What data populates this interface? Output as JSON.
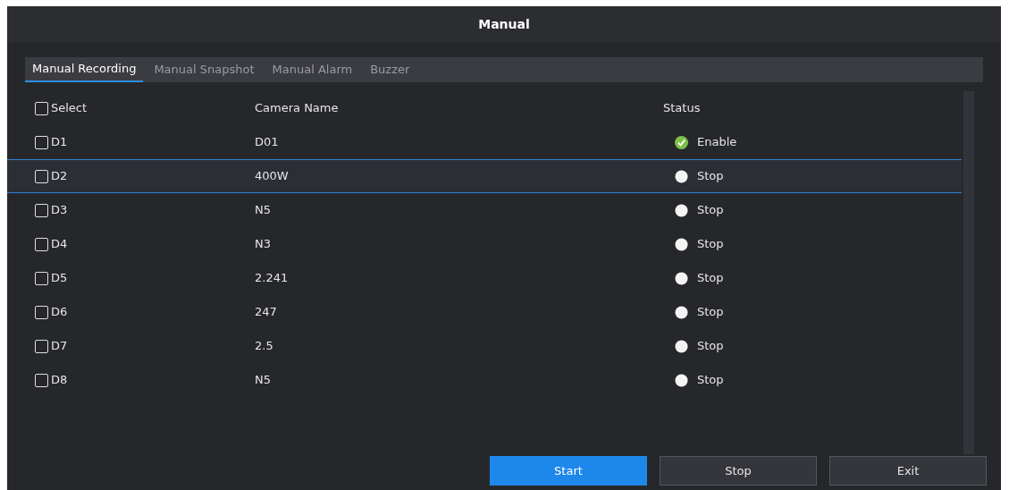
{
  "window": {
    "title": "Manual"
  },
  "tabs": [
    {
      "label": "Manual Recording",
      "selected": true
    },
    {
      "label": "Manual Snapshot",
      "selected": false
    },
    {
      "label": "Manual Alarm",
      "selected": false
    },
    {
      "label": "Buzzer",
      "selected": false
    }
  ],
  "table": {
    "select_all": {
      "label": "Select",
      "checked": false
    },
    "columns": [
      "Camera Name",
      "Status"
    ],
    "rows": [
      {
        "channel": "D1",
        "checked": false,
        "selected": false,
        "camera_name": "D01",
        "status": "Enable",
        "recording": true
      },
      {
        "channel": "D2",
        "checked": false,
        "selected": true,
        "camera_name": "400W",
        "status": "Stop",
        "recording": false
      },
      {
        "channel": "D3",
        "checked": false,
        "selected": false,
        "camera_name": "N5",
        "status": "Stop",
        "recording": false
      },
      {
        "channel": "D4",
        "checked": false,
        "selected": false,
        "camera_name": "N3",
        "status": "Stop",
        "recording": false
      },
      {
        "channel": "D5",
        "checked": false,
        "selected": false,
        "camera_name": "2.241",
        "status": "Stop",
        "recording": false
      },
      {
        "channel": "D6",
        "checked": false,
        "selected": false,
        "camera_name": "247",
        "status": "Stop",
        "recording": false
      },
      {
        "channel": "D7",
        "checked": false,
        "selected": false,
        "camera_name": "2.5",
        "status": "Stop",
        "recording": false
      },
      {
        "channel": "D8",
        "checked": false,
        "selected": false,
        "camera_name": "N5",
        "status": "Stop",
        "recording": false
      }
    ]
  },
  "buttons": [
    {
      "label": "Start",
      "primary": true
    },
    {
      "label": "Stop",
      "primary": false
    },
    {
      "label": "Exit",
      "primary": false
    }
  ]
}
